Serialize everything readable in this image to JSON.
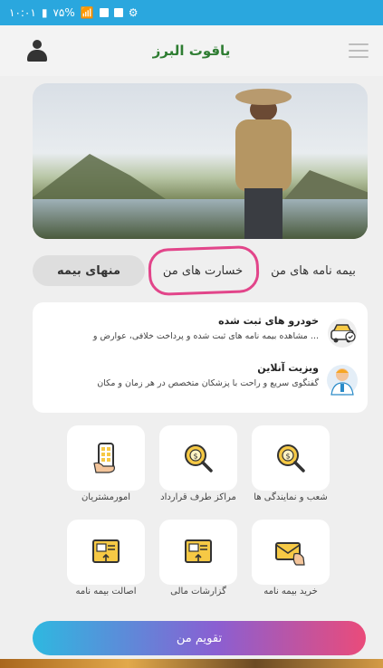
{
  "status_bar": {
    "time": "۱۰:۰۱",
    "battery": "۷۵%",
    "signal": "‏‎‏‏۴G"
  },
  "header": {
    "title": "یاقوت البرز"
  },
  "tabs": [
    {
      "label": "بیمه نامه های من"
    },
    {
      "label": "خسارت های من"
    },
    {
      "label": "منهای بیمه"
    }
  ],
  "features": [
    {
      "title": "خودرو های ثبت شده",
      "subtitle": "مشاهده بیمه نامه های ثبت شده و پرداخت خلافی، عوارض و ...",
      "icon": "car-icon"
    },
    {
      "title": "ویزیت آنلاین",
      "subtitle": "گفتگوی سریع و راحت با پزشکان متخصص در هر زمان و مکان",
      "icon": "doctor-icon"
    }
  ],
  "grid": [
    {
      "label": "شعب و نمایندگی ها",
      "icon": "magnifier-coin-icon"
    },
    {
      "label": "مراکز طرف قرارداد",
      "icon": "magnifier-coin-icon"
    },
    {
      "label": "امورمشتریان",
      "icon": "phone-hand-icon"
    },
    {
      "label": "خرید بیمه نامه",
      "icon": "envelope-hand-icon"
    },
    {
      "label": "گزارشات مالی",
      "icon": "document-upload-icon"
    },
    {
      "label": "اصالت بیمه نامه",
      "icon": "document-upload-icon"
    }
  ],
  "calendar_button": {
    "label": "تقویم من"
  },
  "colors": {
    "status": "#2aa7de",
    "title": "#2e7d32",
    "highlight": "#e2458a"
  }
}
